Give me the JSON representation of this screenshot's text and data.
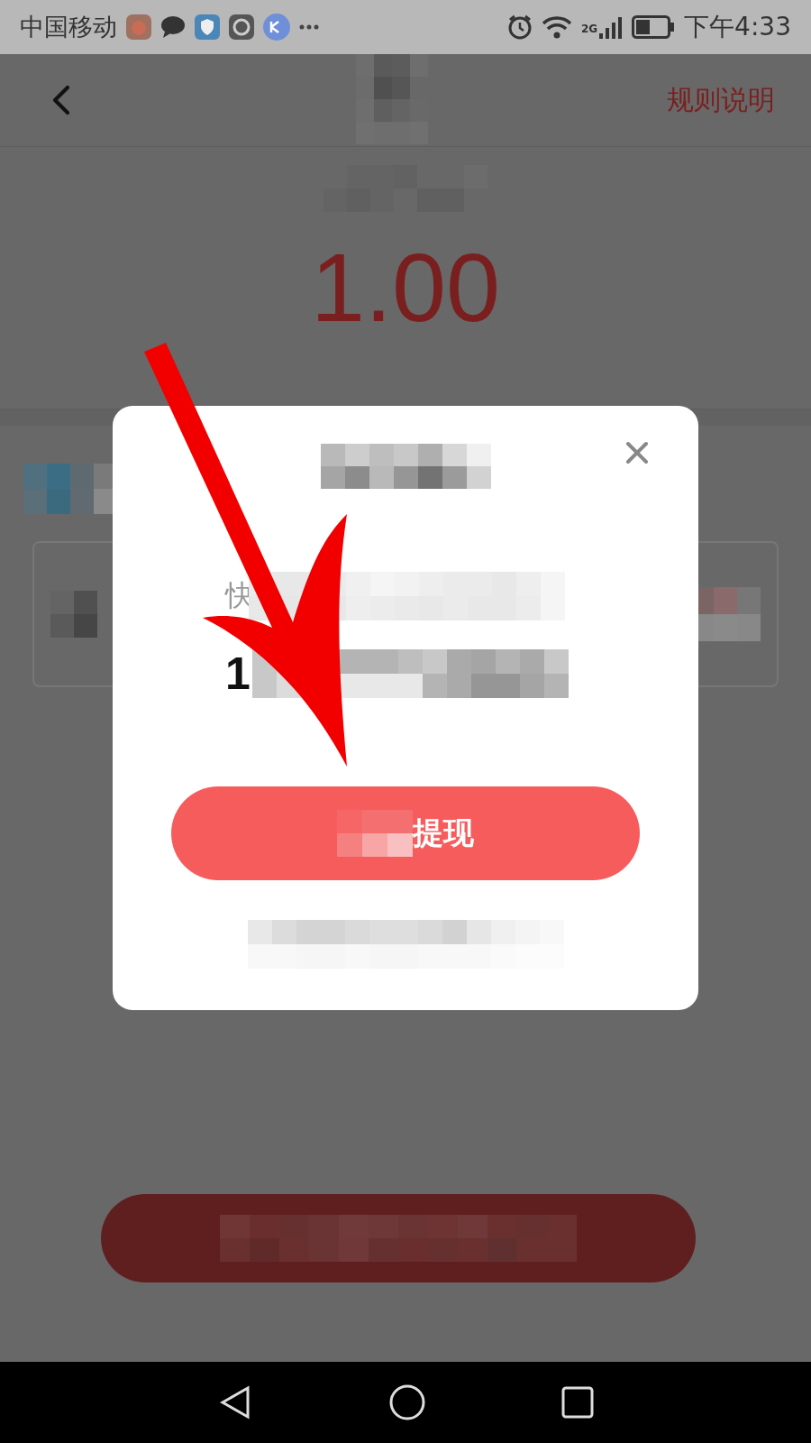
{
  "status_bar": {
    "carrier": "中国移动",
    "network": "2G",
    "time": "下午4:33"
  },
  "header": {
    "action": "规则说明"
  },
  "amount": "1.00",
  "dialog": {
    "label_fragment": "快",
    "number_fragment": "1",
    "button_label": "提现"
  }
}
